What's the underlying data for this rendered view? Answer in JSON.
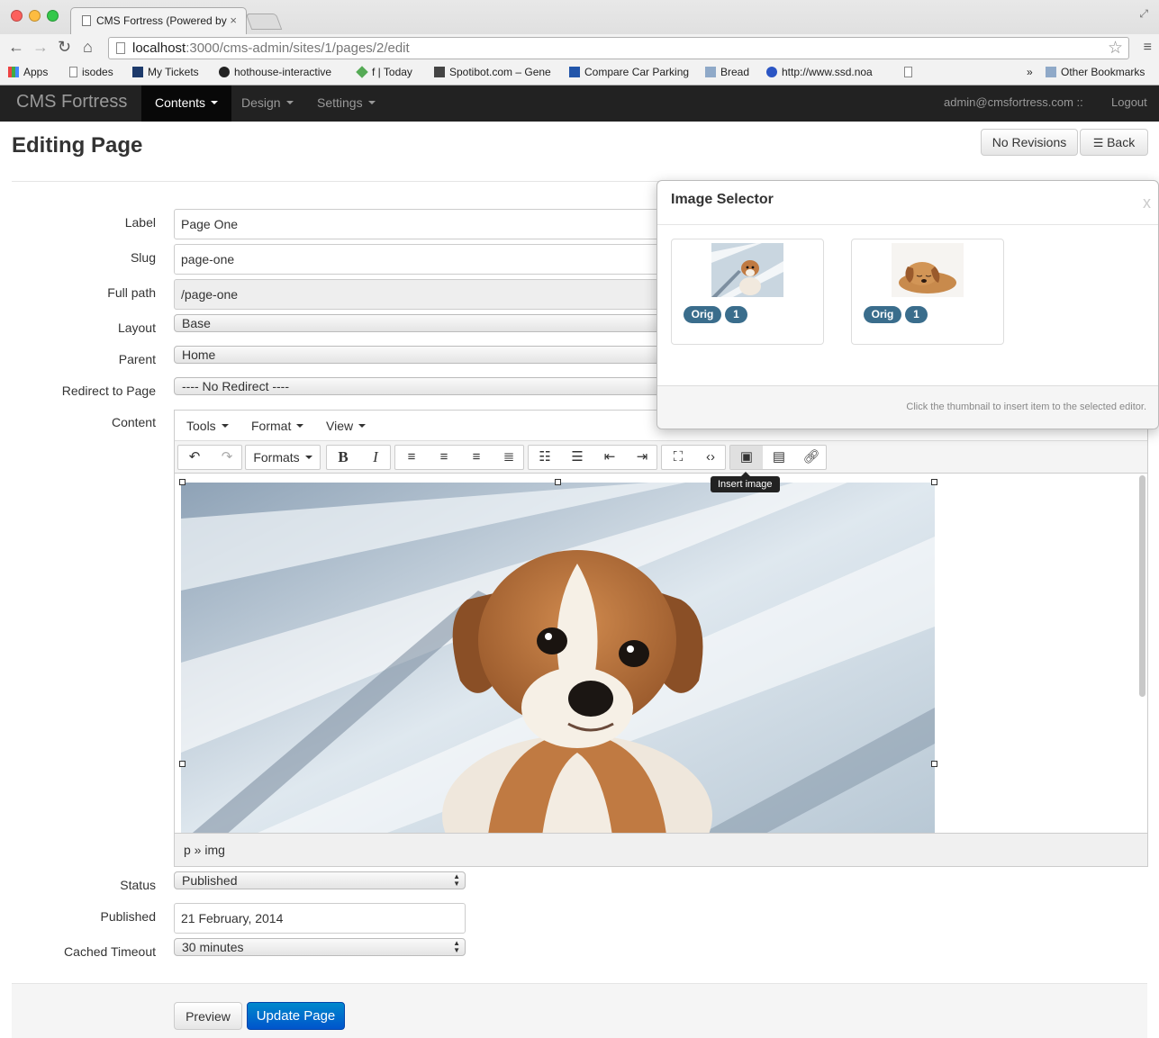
{
  "browser": {
    "tab_title": "CMS Fortress (Powered by",
    "tab_close": "×",
    "url_host": "localhost",
    "url_path": ":3000/cms-admin/sites/1/pages/2/edit",
    "back_icon": "arrow-left-icon",
    "bookmarks": [
      {
        "label": "Apps",
        "icon": "apps-grid-icon"
      },
      {
        "label": "isodes",
        "icon": "page-icon"
      },
      {
        "label": "My Tickets",
        "icon": "tickets-icon"
      },
      {
        "label": "hothouse-interactive",
        "icon": "github-icon"
      },
      {
        "label": "f | Today",
        "icon": "diamond-icon"
      },
      {
        "label": "Spotibot.com – Gene",
        "icon": "spotibot-icon"
      },
      {
        "label": "Compare Car Parking",
        "icon": "parking-icon"
      },
      {
        "label": "Bread",
        "icon": "folder-icon"
      },
      {
        "label": "http://www.ssd.noa",
        "icon": "globe-icon"
      }
    ],
    "more_bookmarks": "»",
    "other_bookmarks": "Other Bookmarks"
  },
  "nav": {
    "brand": "CMS Fortress",
    "items": [
      "Contents",
      "Design",
      "Settings"
    ],
    "user": "admin@cmsfortress.com ::",
    "logout": "Logout"
  },
  "page": {
    "title": "Editing Page",
    "no_revisions": "No Revisions",
    "back": "Back"
  },
  "form": {
    "label": {
      "label": "Label",
      "value": "Page One"
    },
    "slug": {
      "label": "Slug",
      "value": "page-one"
    },
    "full_path": {
      "label": "Full path",
      "value": "/page-one"
    },
    "layout": {
      "label": "Layout",
      "value": "Base"
    },
    "parent": {
      "label": "Parent",
      "value": "Home"
    },
    "redirect": {
      "label": "Redirect to Page",
      "value": "---- No Redirect ----"
    },
    "content": {
      "label": "Content"
    },
    "status": {
      "label": "Status",
      "value": "Published"
    },
    "published": {
      "label": "Published",
      "value": "21 February, 2014"
    },
    "cached_timeout": {
      "label": "Cached Timeout",
      "value": "30 minutes"
    }
  },
  "editor": {
    "menus": [
      "Tools",
      "Format",
      "View"
    ],
    "formats_label": "Formats",
    "tooltip": "Insert image",
    "statusbar_path": "p » img"
  },
  "image_selector": {
    "title": "Image Selector",
    "close": "x",
    "items": [
      {
        "badge": "Orig",
        "count": "1"
      },
      {
        "badge": "Orig",
        "count": "1"
      }
    ],
    "note": "Click the thumbnail to insert item to the selected editor."
  },
  "actions": {
    "preview": "Preview",
    "update": "Update Page"
  },
  "colors": {
    "navbar": "#222222",
    "primary": "#0066cc",
    "badge": "#3a6d8c"
  }
}
